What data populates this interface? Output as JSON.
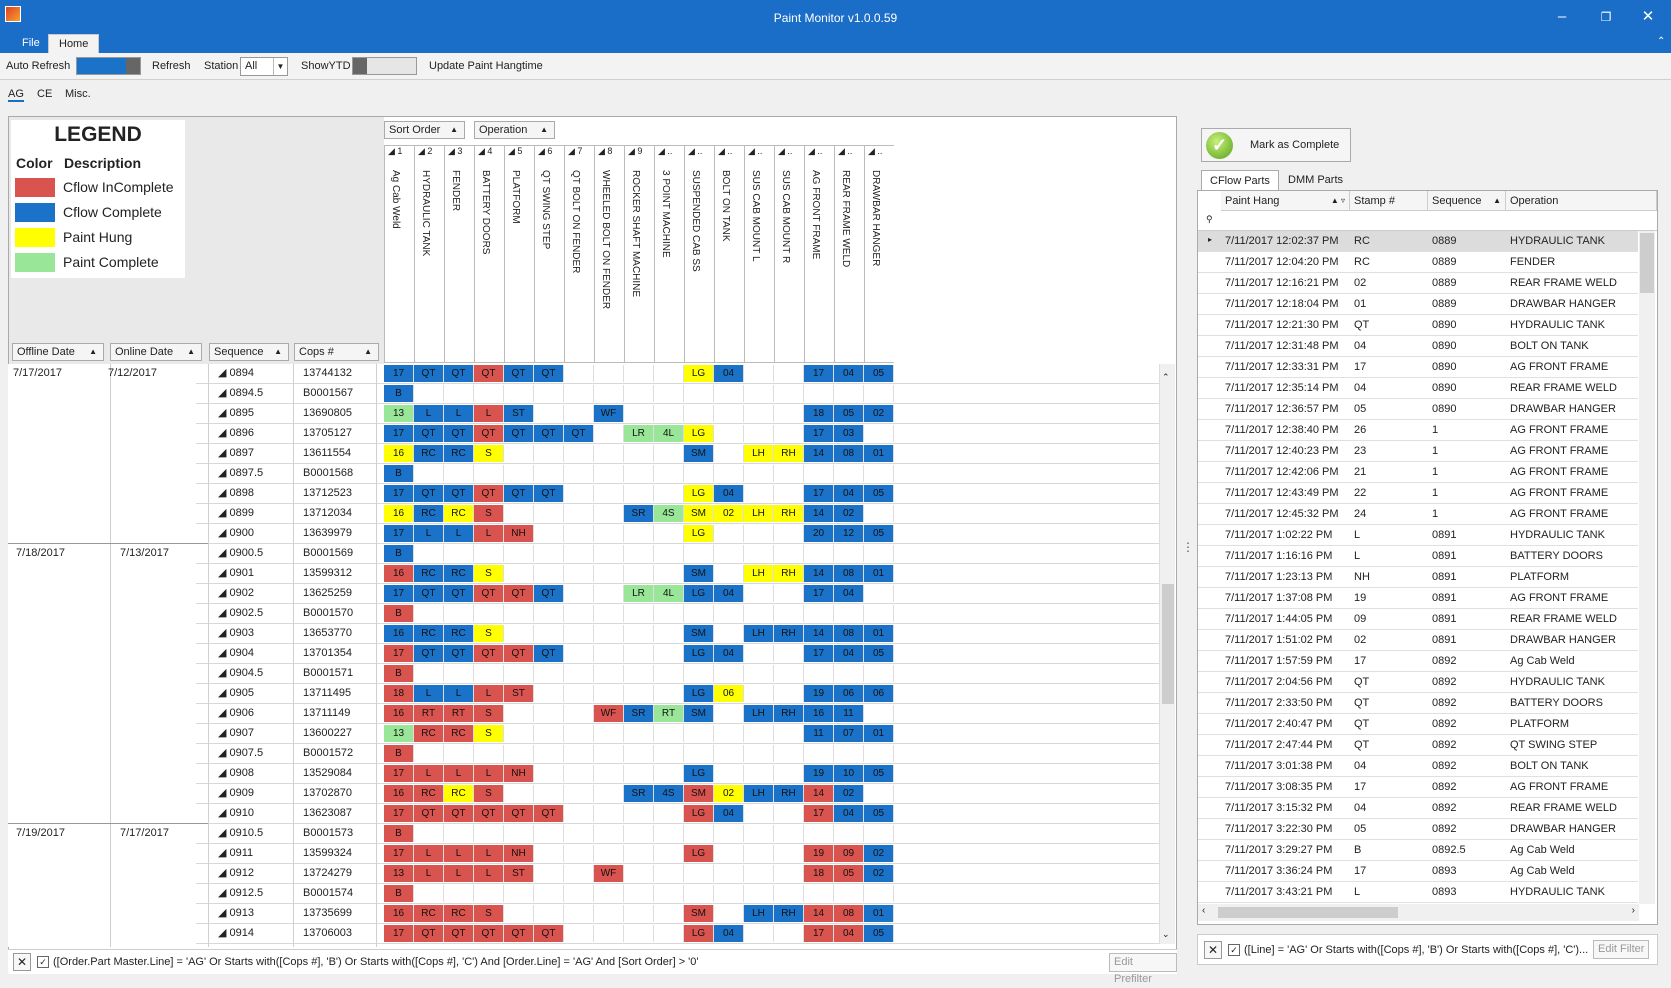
{
  "window": {
    "title": "Paint Monitor v1.0.0.59"
  },
  "ribbon": {
    "file_tab": "File",
    "home_tab": "Home"
  },
  "toolbar": {
    "auto_refresh_label": "Auto Refresh",
    "refresh_label": "Refresh",
    "station_label": "Station",
    "station_value": "All",
    "show_ytd_label": "ShowYTD",
    "update_label": "Update Paint Hangtime"
  },
  "subtabs": [
    "AG",
    "CE",
    "Misc."
  ],
  "legend": {
    "title": "LEGEND",
    "color_header": "Color",
    "desc_header": "Description",
    "items": [
      {
        "label": "Cflow InComplete",
        "color": "#d9534f"
      },
      {
        "label": "Cflow Complete",
        "color": "#1a73c9"
      },
      {
        "label": "Paint Hung",
        "color": "#ffff00"
      },
      {
        "label": "Paint Complete",
        "color": "#99e699"
      }
    ]
  },
  "grid": {
    "sort_order_label": "Sort Order",
    "operation_label": "Operation",
    "headers": {
      "offline": "Offline Date",
      "online": "Online Date",
      "sequence": "Sequence",
      "cops": "Cops #"
    },
    "operations": [
      "Ag Cab Weld",
      "HYDRAULIC TANK",
      "FENDER",
      "BATTERY DOORS",
      "PLATFORM",
      "QT SWING STEP",
      "QT BOLT ON FENDER",
      "WHEELED BOLT ON FENDER",
      "ROCKER SHAFT MACHINE",
      "3 POINT MACHINE",
      "SUSPENDED CAB SS",
      "BOLT ON TANK",
      "SUS CAB MOUNT L",
      "SUS CAB MOUNT R",
      "AG FRONT FRAME",
      "REAR FRAME WELD",
      "DRAWBAR HANGER"
    ],
    "op_numbers": [
      "1",
      "2",
      "3",
      "4",
      "5",
      "6",
      "7",
      "8",
      "9",
      "..",
      "..",
      "..",
      "..",
      "..",
      "..",
      "..",
      ".."
    ],
    "groups": [
      {
        "offline": "7/17/2017",
        "online": "7/12/2017"
      },
      {
        "offline": "7/18/2017",
        "online": "7/13/2017"
      },
      {
        "offline": "7/19/2017",
        "online": "7/17/2017"
      }
    ],
    "rows": [
      {
        "seq": "0894",
        "cops": "13744132",
        "cells": [
          "b17",
          "bQT",
          "bQT",
          "rQT",
          "bQT",
          "bQT",
          "",
          "",
          "",
          "",
          "yLG",
          "b04",
          "",
          "",
          "b17",
          "b04",
          "b05"
        ]
      },
      {
        "seq": "0894.5",
        "cops": "B0001567",
        "cells": [
          "bB",
          "",
          "",
          "",
          "",
          "",
          "",
          "",
          "",
          "",
          "",
          "",
          "",
          "",
          "",
          "",
          ""
        ]
      },
      {
        "seq": "0895",
        "cops": "13690805",
        "cells": [
          "g13",
          "bL",
          "bL",
          "rL",
          "bST",
          "",
          "",
          "bWF",
          "",
          "",
          "",
          "",
          "",
          "",
          "b18",
          "b05",
          "b02"
        ]
      },
      {
        "seq": "0896",
        "cops": "13705127",
        "cells": [
          "b17",
          "bQT",
          "bQT",
          "rQT",
          "bQT",
          "bQT",
          "bQT",
          "",
          "gLR",
          "g4L",
          "yLG",
          "",
          "",
          "",
          "b17",
          "b03",
          ""
        ]
      },
      {
        "seq": "0897",
        "cops": "13611554",
        "cells": [
          "y16",
          "bRC",
          "bRC",
          "yS",
          "",
          "",
          "",
          "",
          "",
          "",
          "bSM",
          "",
          "yLH",
          "yRH",
          "b14",
          "b08",
          "b01"
        ]
      },
      {
        "seq": "0897.5",
        "cops": "B0001568",
        "cells": [
          "bB",
          "",
          "",
          "",
          "",
          "",
          "",
          "",
          "",
          "",
          "",
          "",
          "",
          "",
          "",
          "",
          ""
        ]
      },
      {
        "seq": "0898",
        "cops": "13712523",
        "cells": [
          "b17",
          "bQT",
          "bQT",
          "rQT",
          "bQT",
          "bQT",
          "",
          "",
          "",
          "",
          "yLG",
          "b04",
          "",
          "",
          "b17",
          "b04",
          "b05"
        ]
      },
      {
        "seq": "0899",
        "cops": "13712034",
        "cells": [
          "y16",
          "bRC",
          "yRC",
          "rS",
          "",
          "",
          "",
          "",
          "bSR",
          "g4S",
          "ySM",
          "y02",
          "yLH",
          "yRH",
          "b14",
          "b02",
          ""
        ]
      },
      {
        "seq": "0900",
        "cops": "13639979",
        "cells": [
          "b17",
          "bL",
          "bL",
          "rL",
          "rNH",
          "",
          "",
          "",
          "",
          "",
          "yLG",
          "",
          "",
          "",
          "b20",
          "b12",
          "b05"
        ]
      },
      {
        "seq": "0900.5",
        "cops": "B0001569",
        "cells": [
          "bB",
          "",
          "",
          "",
          "",
          "",
          "",
          "",
          "",
          "",
          "",
          "",
          "",
          "",
          "",
          "",
          ""
        ]
      },
      {
        "seq": "0901",
        "cops": "13599312",
        "cells": [
          "r16",
          "bRC",
          "bRC",
          "yS",
          "",
          "",
          "",
          "",
          "",
          "",
          "bSM",
          "",
          "yLH",
          "yRH",
          "b14",
          "b08",
          "b01"
        ]
      },
      {
        "seq": "0902",
        "cops": "13625259",
        "cells": [
          "b17",
          "bQT",
          "bQT",
          "rQT",
          "rQT",
          "bQT",
          "",
          "",
          "gLR",
          "g4L",
          "bLG",
          "b04",
          "",
          "",
          "b17",
          "b04",
          ""
        ]
      },
      {
        "seq": "0902.5",
        "cops": "B0001570",
        "cells": [
          "rB",
          "",
          "",
          "",
          "",
          "",
          "",
          "",
          "",
          "",
          "",
          "",
          "",
          "",
          "",
          "",
          ""
        ]
      },
      {
        "seq": "0903",
        "cops": "13653770",
        "cells": [
          "b16",
          "bRC",
          "bRC",
          "yS",
          "",
          "",
          "",
          "",
          "",
          "",
          "bSM",
          "",
          "bLH",
          "bRH",
          "b14",
          "b08",
          "b01"
        ]
      },
      {
        "seq": "0904",
        "cops": "13701354",
        "cells": [
          "r17",
          "bQT",
          "bQT",
          "rQT",
          "rQT",
          "bQT",
          "",
          "",
          "",
          "",
          "bLG",
          "b04",
          "",
          "",
          "b17",
          "b04",
          "b05"
        ]
      },
      {
        "seq": "0904.5",
        "cops": "B0001571",
        "cells": [
          "rB",
          "",
          "",
          "",
          "",
          "",
          "",
          "",
          "",
          "",
          "",
          "",
          "",
          "",
          "",
          "",
          ""
        ]
      },
      {
        "seq": "0905",
        "cops": "13711495",
        "cells": [
          "r18",
          "bL",
          "bL",
          "rL",
          "rST",
          "",
          "",
          "",
          "",
          "",
          "bLG",
          "y06",
          "",
          "",
          "b19",
          "b06",
          "b06"
        ]
      },
      {
        "seq": "0906",
        "cops": "13711149",
        "cells": [
          "r16",
          "rRT",
          "rRT",
          "rS",
          "",
          "",
          "",
          "rWF",
          "bSR",
          "gRT",
          "bSM",
          "",
          "bLH",
          "bRH",
          "b16",
          "b11",
          ""
        ]
      },
      {
        "seq": "0907",
        "cops": "13600227",
        "cells": [
          "g13",
          "rRC",
          "rRC",
          "yS",
          "",
          "",
          "",
          "",
          "",
          "",
          "",
          "",
          "",
          "",
          "b11",
          "b07",
          "b01"
        ]
      },
      {
        "seq": "0907.5",
        "cops": "B0001572",
        "cells": [
          "rB",
          "",
          "",
          "",
          "",
          "",
          "",
          "",
          "",
          "",
          "",
          "",
          "",
          "",
          "",
          "",
          ""
        ]
      },
      {
        "seq": "0908",
        "cops": "13529084",
        "cells": [
          "r17",
          "rL",
          "rL",
          "rL",
          "rNH",
          "",
          "",
          "",
          "",
          "",
          "bLG",
          "",
          "",
          "",
          "b19",
          "b10",
          "b05"
        ]
      },
      {
        "seq": "0909",
        "cops": "13702870",
        "cells": [
          "r16",
          "rRC",
          "yRC",
          "rS",
          "",
          "",
          "",
          "",
          "bSR",
          "b4S",
          "rSM",
          "y02",
          "bLH",
          "bRH",
          "r14",
          "b02",
          ""
        ]
      },
      {
        "seq": "0910",
        "cops": "13623087",
        "cells": [
          "r17",
          "rQT",
          "rQT",
          "rQT",
          "rQT",
          "rQT",
          "",
          "",
          "",
          "",
          "rLG",
          "b04",
          "",
          "",
          "r17",
          "b04",
          "b05"
        ]
      },
      {
        "seq": "0910.5",
        "cops": "B0001573",
        "cells": [
          "rB",
          "",
          "",
          "",
          "",
          "",
          "",
          "",
          "",
          "",
          "",
          "",
          "",
          "",
          "",
          "",
          ""
        ]
      },
      {
        "seq": "0911",
        "cops": "13599324",
        "cells": [
          "r17",
          "rL",
          "rL",
          "rL",
          "rNH",
          "",
          "",
          "",
          "",
          "",
          "rLG",
          "",
          "",
          "",
          "r19",
          "r09",
          "b02"
        ]
      },
      {
        "seq": "0912",
        "cops": "13724279",
        "cells": [
          "r13",
          "rL",
          "rL",
          "rL",
          "rST",
          "",
          "",
          "rWF",
          "",
          "",
          "",
          "",
          "",
          "",
          "r18",
          "r05",
          "b02"
        ]
      },
      {
        "seq": "0912.5",
        "cops": "B0001574",
        "cells": [
          "rB",
          "",
          "",
          "",
          "",
          "",
          "",
          "",
          "",
          "",
          "",
          "",
          "",
          "",
          "",
          "",
          ""
        ]
      },
      {
        "seq": "0913",
        "cops": "13735699",
        "cells": [
          "r16",
          "rRC",
          "rRC",
          "rS",
          "",
          "",
          "",
          "",
          "",
          "",
          "rSM",
          "",
          "bLH",
          "bRH",
          "r14",
          "r08",
          "b01"
        ]
      },
      {
        "seq": "0914",
        "cops": "13706003",
        "cells": [
          "r17",
          "rQT",
          "rQT",
          "rQT",
          "rQT",
          "rQT",
          "",
          "",
          "",
          "",
          "rLG",
          "b04",
          "",
          "",
          "r17",
          "r04",
          "b05"
        ]
      }
    ],
    "filter_text": "([Order.Part Master.Line] = 'AG' Or Starts with([Cops #], 'B') Or Starts with([Cops #], 'C') And [Order.Line] = 'AG' And [Sort Order] > '0'",
    "edit_prefilter": "Edit Prefilter"
  },
  "right": {
    "mark_complete": "Mark as Complete",
    "tabs": [
      "CFlow Parts",
      "DMM Parts"
    ],
    "headers": {
      "paint_hang": "Paint Hang",
      "stamp": "Stamp #",
      "sequence": "Sequence",
      "operation": "Operation"
    },
    "rows": [
      [
        "7/11/2017 12:02:37 PM",
        "RC",
        "0889",
        "HYDRAULIC TANK"
      ],
      [
        "7/11/2017 12:04:20 PM",
        "RC",
        "0889",
        "FENDER"
      ],
      [
        "7/11/2017 12:16:21 PM",
        "02",
        "0889",
        "REAR FRAME WELD"
      ],
      [
        "7/11/2017 12:18:04 PM",
        "01",
        "0889",
        "DRAWBAR HANGER"
      ],
      [
        "7/11/2017 12:21:30 PM",
        "QT",
        "0890",
        "HYDRAULIC TANK"
      ],
      [
        "7/11/2017 12:31:48 PM",
        "04",
        "0890",
        "BOLT ON TANK"
      ],
      [
        "7/11/2017 12:33:31 PM",
        "17",
        "0890",
        "AG FRONT FRAME"
      ],
      [
        "7/11/2017 12:35:14 PM",
        "04",
        "0890",
        "REAR FRAME WELD"
      ],
      [
        "7/11/2017 12:36:57 PM",
        "05",
        "0890",
        "DRAWBAR HANGER"
      ],
      [
        "7/11/2017 12:38:40 PM",
        "26",
        "1",
        "AG FRONT FRAME"
      ],
      [
        "7/11/2017 12:40:23 PM",
        "23",
        "1",
        "AG FRONT FRAME"
      ],
      [
        "7/11/2017 12:42:06 PM",
        "21",
        "1",
        "AG FRONT FRAME"
      ],
      [
        "7/11/2017 12:43:49 PM",
        "22",
        "1",
        "AG FRONT FRAME"
      ],
      [
        "7/11/2017 12:45:32 PM",
        "24",
        "1",
        "AG FRONT FRAME"
      ],
      [
        "7/11/2017 1:02:22 PM",
        "L",
        "0891",
        "HYDRAULIC TANK"
      ],
      [
        "7/11/2017 1:16:16 PM",
        "L",
        "0891",
        "BATTERY DOORS"
      ],
      [
        "7/11/2017 1:23:13 PM",
        "NH",
        "0891",
        "PLATFORM"
      ],
      [
        "7/11/2017 1:37:08 PM",
        "19",
        "0891",
        "AG FRONT FRAME"
      ],
      [
        "7/11/2017 1:44:05 PM",
        "09",
        "0891",
        "REAR FRAME WELD"
      ],
      [
        "7/11/2017 1:51:02 PM",
        "02",
        "0891",
        "DRAWBAR HANGER"
      ],
      [
        "7/11/2017 1:57:59 PM",
        "17",
        "0892",
        "Ag Cab Weld"
      ],
      [
        "7/11/2017 2:04:56 PM",
        "QT",
        "0892",
        "HYDRAULIC TANK"
      ],
      [
        "7/11/2017 2:33:50 PM",
        "QT",
        "0892",
        "BATTERY DOORS"
      ],
      [
        "7/11/2017 2:40:47 PM",
        "QT",
        "0892",
        "PLATFORM"
      ],
      [
        "7/11/2017 2:47:44 PM",
        "QT",
        "0892",
        "QT SWING STEP"
      ],
      [
        "7/11/2017 3:01:38 PM",
        "04",
        "0892",
        "BOLT ON TANK"
      ],
      [
        "7/11/2017 3:08:35 PM",
        "17",
        "0892",
        "AG FRONT FRAME"
      ],
      [
        "7/11/2017 3:15:32 PM",
        "04",
        "0892",
        "REAR FRAME WELD"
      ],
      [
        "7/11/2017 3:22:30 PM",
        "05",
        "0892",
        "DRAWBAR HANGER"
      ],
      [
        "7/11/2017 3:29:27 PM",
        "B",
        "0892.5",
        "Ag Cab Weld"
      ],
      [
        "7/11/2017 3:36:24 PM",
        "17",
        "0893",
        "Ag Cab Weld"
      ],
      [
        "7/11/2017 3:43:21 PM",
        "L",
        "0893",
        "HYDRAULIC TANK"
      ]
    ],
    "filter_text": "([Line] = 'AG' Or Starts with([Cops #], 'B') Or Starts with([Cops #], 'C')...",
    "edit_filter": "Edit Filter"
  }
}
